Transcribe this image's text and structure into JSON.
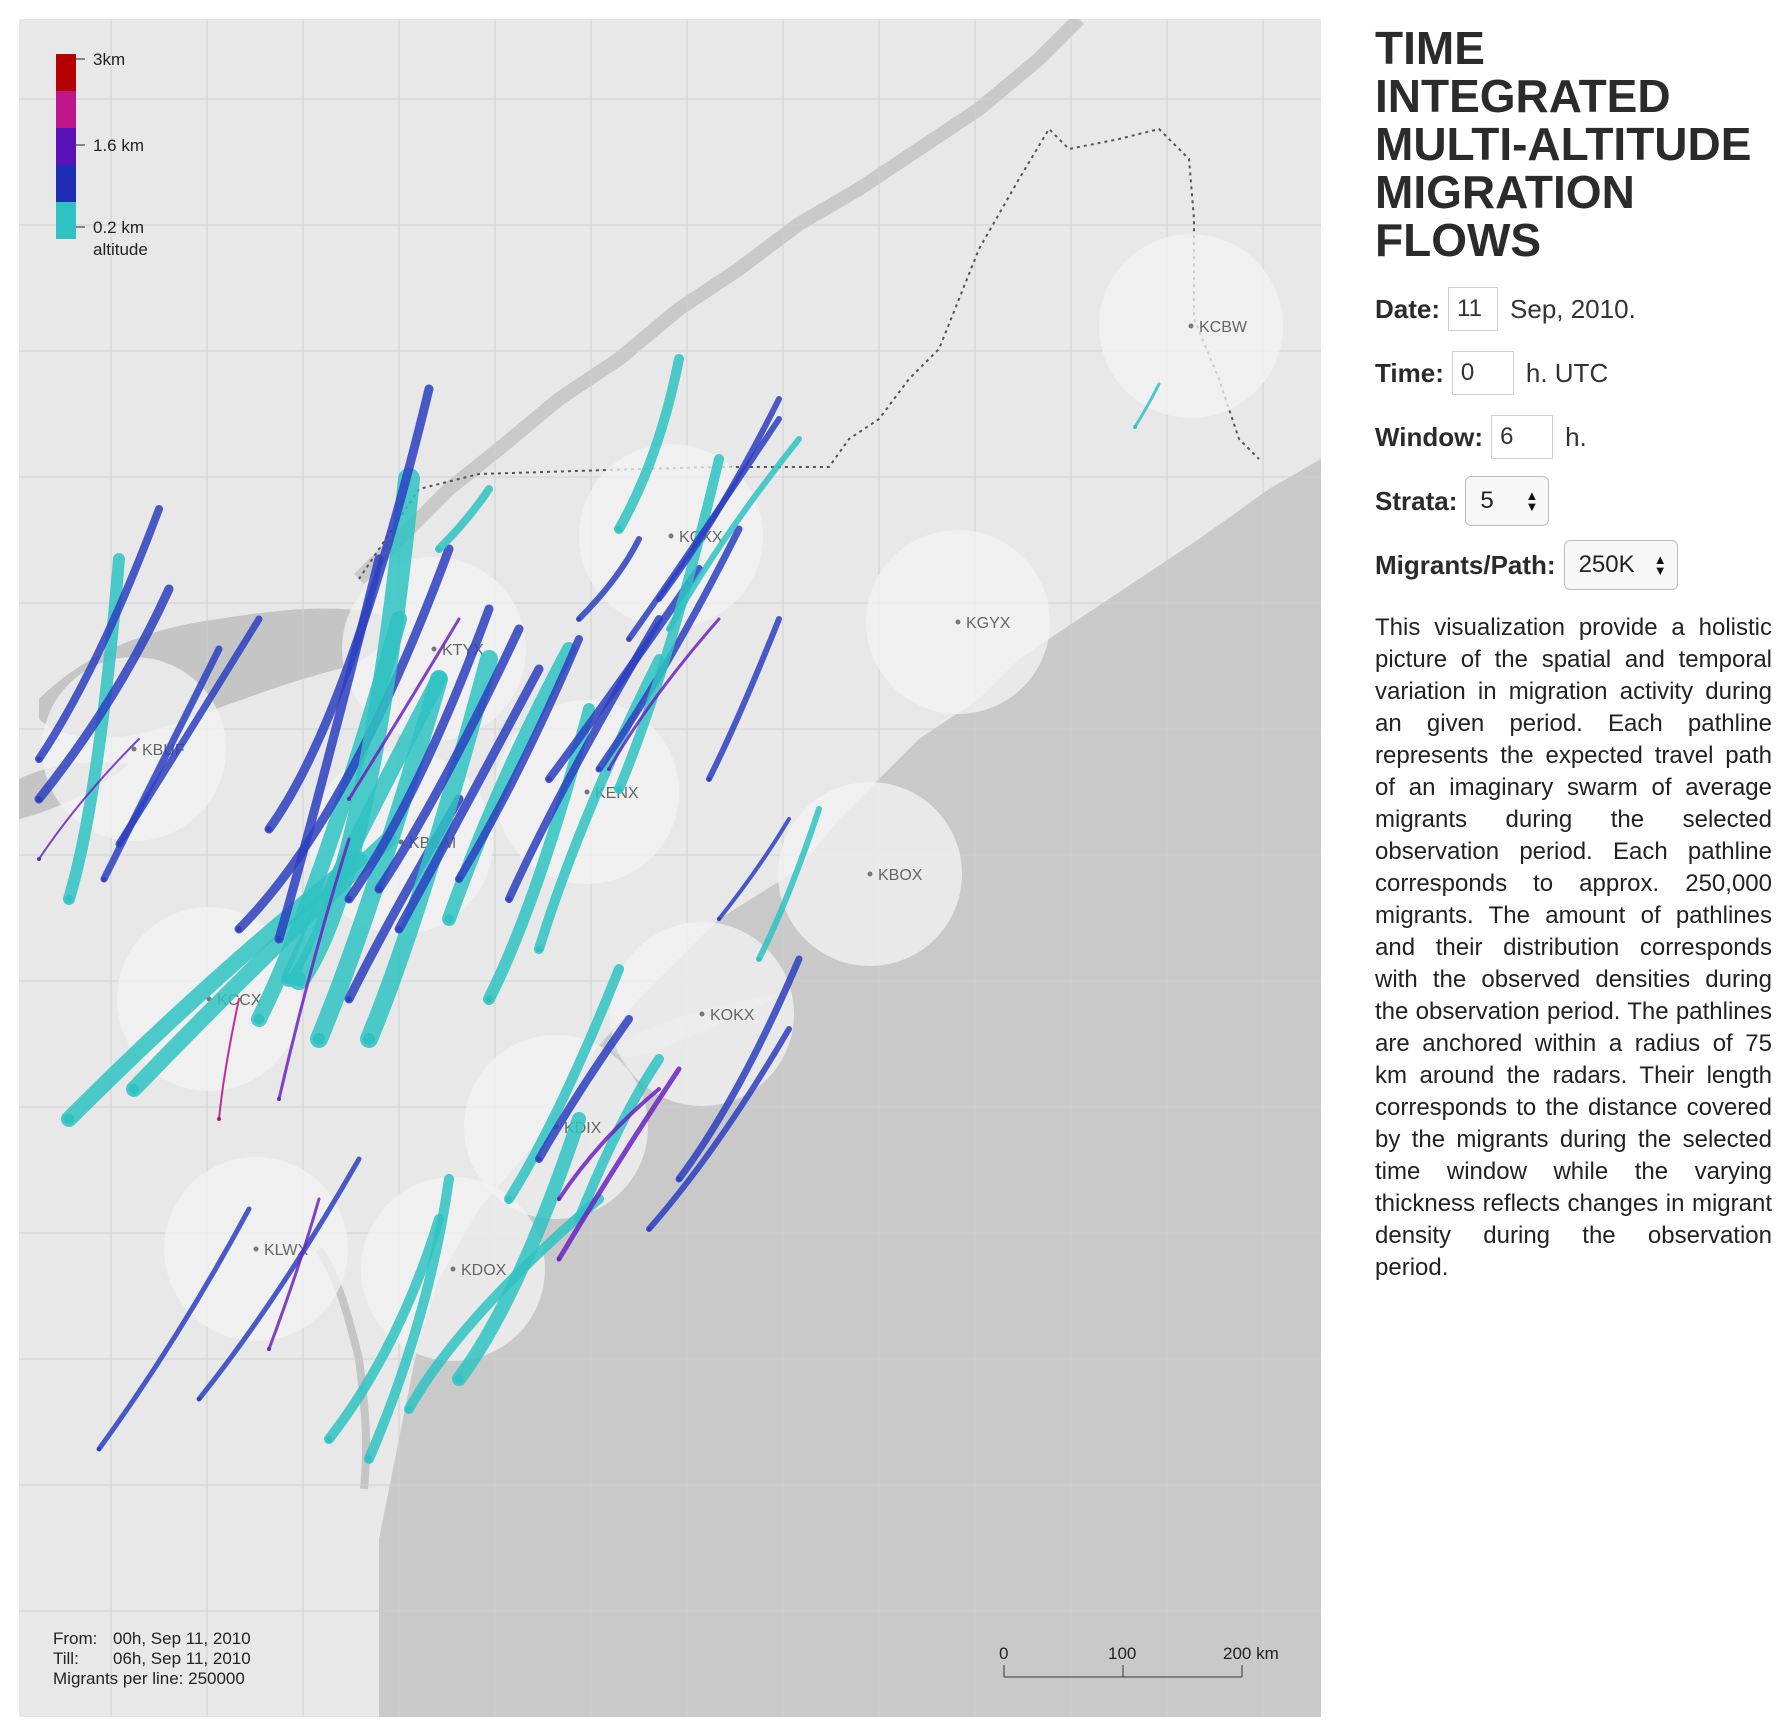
{
  "panel": {
    "title": "Time Integrated Multi-Altitude Migration Flows",
    "date_label": "Date:",
    "date_value": "11",
    "date_suffix": "Sep, 2010.",
    "time_label": "Time:",
    "time_value": "0",
    "time_suffix": "h. UTC",
    "window_label": "Window:",
    "window_value": "6",
    "window_suffix": "h.",
    "strata_label": "Strata:",
    "strata_value": "5",
    "migrants_label": "Migrants/Path:",
    "migrants_value": "250K",
    "description": "This visualization provide a holistic picture of the spatial and temporal variation in migration activity during an given period. Each pathline represents the expected travel path of an imaginary swarm of average migrants during the selected observation period. Each pathline corresponds to approx. 250,000 migrants. The amount of pathlines and their distribution corresponds with the observed densities during the observation period. The pathlines are anchored within a radius of 75 km around the radars. Their length corresponds to the distance covered by the migrants during the selected time window while the varying thickness reflects changes in migrant density during the observation period."
  },
  "legend": {
    "top_label": "3km",
    "mid_label": "1.6 km",
    "bottom_label": "0.2 km",
    "axis_label": "altitude",
    "colors": [
      "#b30000",
      "#c0168a",
      "#5a11b8",
      "#1f2fb5",
      "#2fc2c2"
    ]
  },
  "footer": {
    "from_label": "From:",
    "from_value": "00h, Sep 11, 2010",
    "till_label": "Till:",
    "till_value": "06h, Sep 11, 2010",
    "migrants_line": "Migrants per line: 250000"
  },
  "scale": {
    "labels": [
      "0",
      "100",
      "200 km"
    ]
  },
  "radars": [
    "KCBW",
    "KCXX",
    "KGYX",
    "KTYX",
    "KBUF",
    "KENX",
    "KBOX",
    "KBGM",
    "KCCX",
    "KOKX",
    "KDIX",
    "KLWX",
    "KDOX"
  ],
  "colors": {
    "map_background": "#e8e8e8",
    "land_dark": "#c9c9c9",
    "water": "#c5c5c5",
    "teal": "#2fc2c2",
    "blue": "#2b3fc0",
    "purple": "#6a22c0"
  }
}
